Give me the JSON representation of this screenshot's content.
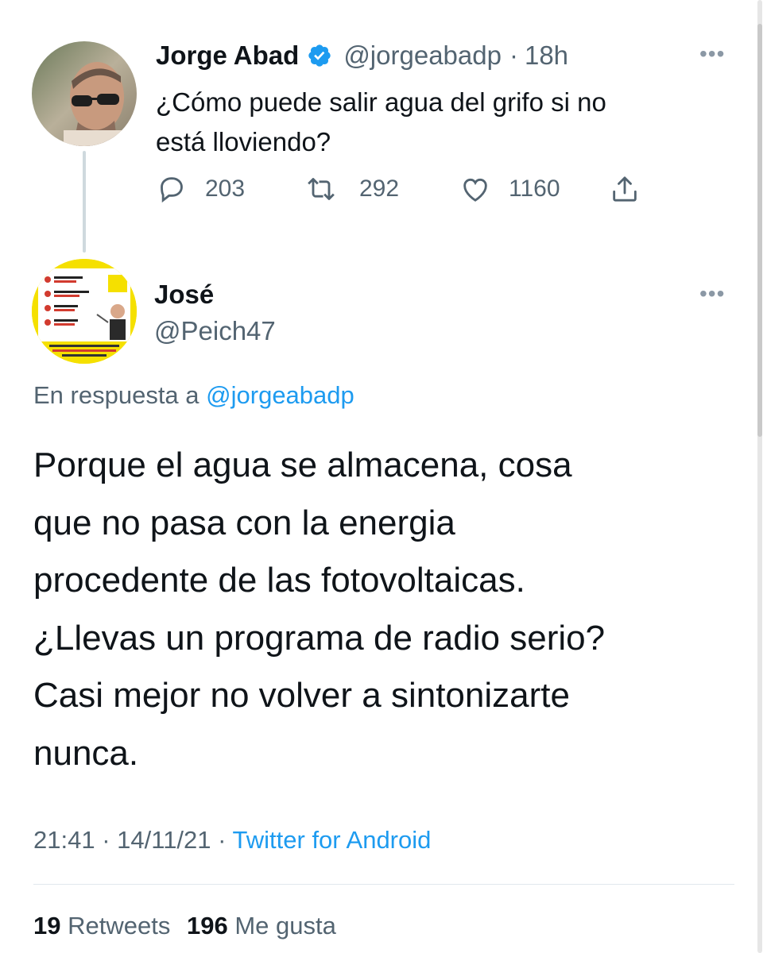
{
  "original_tweet": {
    "display_name": "Jorge Abad",
    "handle": "@jorgeabadp",
    "separator": "·",
    "time_ago": "18h",
    "text_line1": "¿Cómo puede salir agua del grifo si no",
    "text_line2": "está lloviendo?",
    "verified_icon": "verified-badge-icon",
    "replies": "203",
    "retweets": "292",
    "likes": "1160",
    "more_icon": "more-dots-icon"
  },
  "reply_tweet": {
    "display_name": "José",
    "handle": "@Peich47",
    "in_reply_prefix": "En respuesta a",
    "in_reply_handle": "@jorgeabadp",
    "text_lines": [
      "Porque el agua se almacena, cosa",
      "que no pasa con la energia",
      "procedente de las fotovoltaicas.",
      "¿Llevas un programa de radio serio?",
      "Casi mejor no volver a sintonizarte",
      "nunca."
    ],
    "timestamp_time": "21:41",
    "timestamp_date": "14/11/21",
    "sep": "·",
    "source": "Twitter for Android",
    "retweets_count": "19",
    "retweets_label": "Retweets",
    "likes_count": "196",
    "likes_label": "Me gusta"
  },
  "colors": {
    "link": "#1d9bf0",
    "muted": "#536471",
    "text": "#0f1419",
    "avatar_frame_yellow": "#f5e000"
  }
}
